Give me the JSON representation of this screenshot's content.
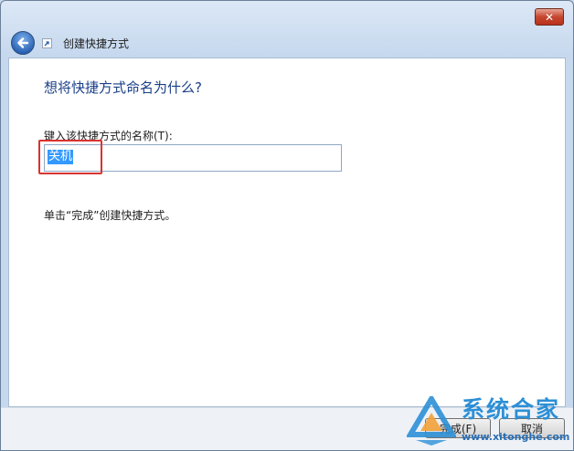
{
  "window": {
    "close_glyph": "✕"
  },
  "nav": {
    "back_icon": "back-arrow-icon",
    "shortcut_icon": "shortcut-icon",
    "title": "创建快捷方式"
  },
  "content": {
    "heading": "想将快捷方式命名为什么?",
    "field_label": "键入该快捷方式的名称(T):",
    "name_value": "关机",
    "finish_note": "单击“完成”创建快捷方式。"
  },
  "buttons": {
    "finish_label": "完成(F)",
    "cancel_label": "取消"
  },
  "watermark": {
    "brand": "系统合家",
    "url": "www.xitonghe.com"
  },
  "colors": {
    "heading": "#1a3f88",
    "selection": "#3399ff",
    "annotation_box": "#d9332f",
    "close_button": "#c6462f",
    "watermark": "#2c8fd6"
  }
}
